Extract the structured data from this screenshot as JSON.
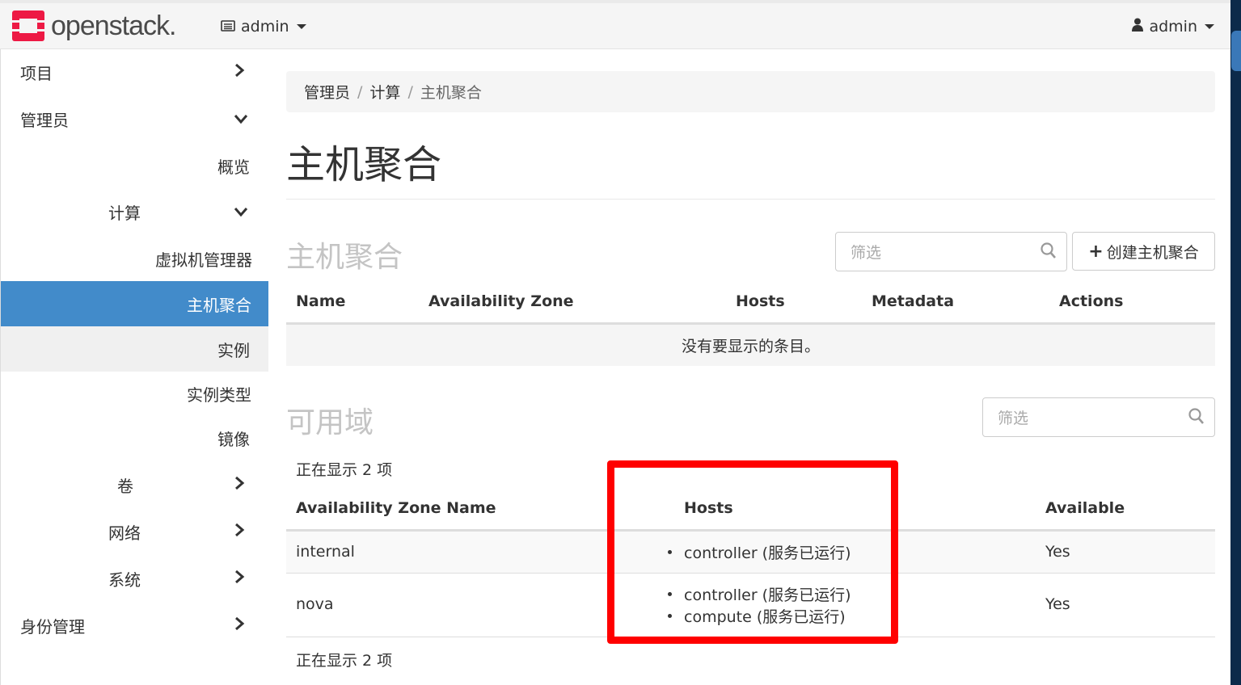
{
  "topbar": {
    "logo_text": "openstack.",
    "project_selector": "admin",
    "user_menu": "admin"
  },
  "sidebar": {
    "items": [
      {
        "label": "项目"
      },
      {
        "label": "管理员"
      },
      {
        "label": "概览"
      },
      {
        "label": "计算"
      },
      {
        "label": "虚拟机管理器"
      },
      {
        "label": "主机聚合"
      },
      {
        "label": "实例"
      },
      {
        "label": "实例类型"
      },
      {
        "label": "镜像"
      },
      {
        "label": "卷"
      },
      {
        "label": "网络"
      },
      {
        "label": "系统"
      },
      {
        "label": "身份管理"
      }
    ]
  },
  "breadcrumb": [
    "管理员",
    "计算",
    "主机聚合"
  ],
  "page_title": "主机聚合",
  "aggregates": {
    "title": "主机聚合",
    "filter_placeholder": "筛选",
    "create_button": "创建主机聚合",
    "columns": [
      "Name",
      "Availability Zone",
      "Hosts",
      "Metadata",
      "Actions"
    ],
    "empty_message": "没有要显示的条目。"
  },
  "zones": {
    "title": "可用域",
    "filter_placeholder": "筛选",
    "count_top": "正在显示 2 项",
    "count_bottom": "正在显示 2 项",
    "columns": [
      "Availability Zone Name",
      "Hosts",
      "Available"
    ],
    "rows": [
      {
        "name": "internal",
        "hosts": [
          "controller (服务已运行)"
        ],
        "available": "Yes"
      },
      {
        "name": "nova",
        "hosts": [
          "controller (服务已运行)",
          "compute (服务已运行)"
        ],
        "available": "Yes"
      }
    ]
  },
  "colors": {
    "accent": "#428bca",
    "logo_red": "#ed1944",
    "highlight": "#ff0000"
  }
}
